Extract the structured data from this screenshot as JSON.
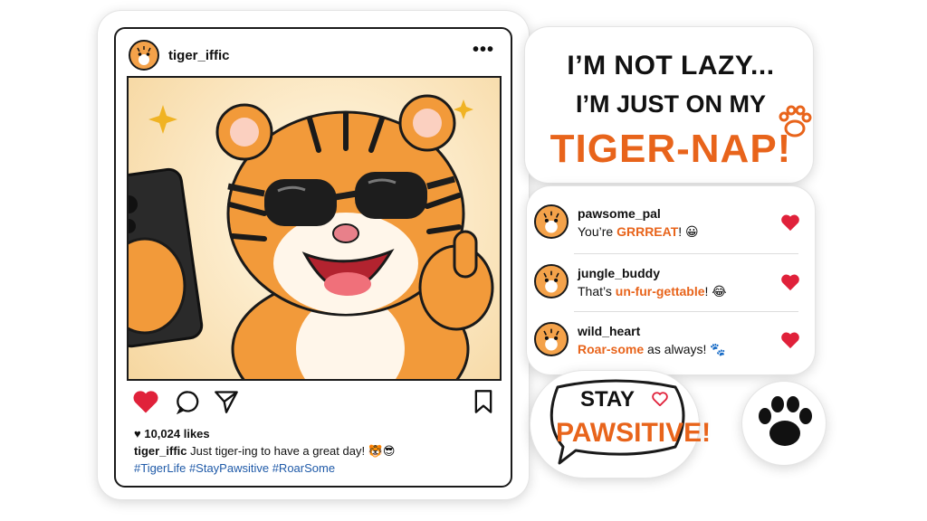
{
  "post": {
    "username": "tiger_iffic",
    "more": "•••",
    "likes": "10,024 likes",
    "caption_user": "tiger_iffic",
    "caption_text": " Just tiger-ing to have a great day! 🐯😎",
    "hashtags": "#TigerLife #StayPawsitive #RoarSome",
    "actions": [
      "heart-icon",
      "comment-icon",
      "share-icon",
      "bookmark-icon"
    ]
  },
  "title": {
    "line1": "I’M NOT LAZY...",
    "line2": "I’M JUST ON MY",
    "line3": "TIGER-NAP!"
  },
  "comments": [
    {
      "user": "pawsome_pal",
      "pre": "You’re ",
      "highlight": "GRRREAT",
      "post": "! 😀"
    },
    {
      "user": "jungle_buddy",
      "pre": "That’s ",
      "highlight": "un-fur-gettable",
      "post": "! 😂"
    },
    {
      "user": "wild_heart",
      "pre": "",
      "highlight": "Roar-some",
      "post": " as always! 🐾"
    }
  ],
  "bubble": {
    "line1": "STAY",
    "line2": "PAWSITIVE!"
  },
  "colors": {
    "accent": "#e8641b",
    "like": "#e0213a",
    "hashtag": "#1f5aa8"
  }
}
